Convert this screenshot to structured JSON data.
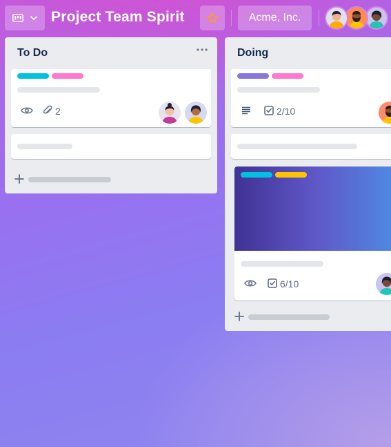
{
  "board": {
    "title": "Project Team Spirit",
    "organization": "Acme, Inc.",
    "starred": true,
    "member_count_visible": 3
  },
  "colors": {
    "label_cyan": "#00c2e0",
    "label_pink": "#ff78cb",
    "label_purple": "#8777d9",
    "label_yellow": "#ffc400",
    "list_bg": "#ebecf0",
    "star_orange": "#ff9f1a"
  },
  "lists": [
    {
      "title": "To Do",
      "cards": [
        {
          "labels": [
            "cyan",
            "pink"
          ],
          "badges": {
            "watch": true,
            "attachments": "2"
          },
          "members": [
            "avatar-woman-bun",
            "avatar-woman-yellow"
          ]
        },
        {
          "labels": [],
          "badges": {}
        }
      ]
    },
    {
      "title": "Doing",
      "cards": [
        {
          "labels": [
            "purple",
            "pink"
          ],
          "badges": {
            "description": true,
            "checklist": "2/10"
          },
          "members": [
            "avatar-man-orange"
          ]
        },
        {
          "labels": [],
          "badges": {}
        },
        {
          "cover": "gradient",
          "labels": [
            "cyan",
            "yellow"
          ],
          "badges": {
            "watch": true,
            "checklist": "6/10"
          },
          "members": [
            "avatar-woman-teal"
          ]
        }
      ]
    }
  ],
  "icons": {
    "board_switcher": "board-icon",
    "chevron": "chevron-down-icon",
    "star": "star-icon",
    "list_menu": "more-horizontal-icon",
    "watch": "eye-icon",
    "attachment": "paperclip-icon",
    "description": "description-icon",
    "checklist": "checkbox-icon",
    "add": "plus-icon"
  }
}
